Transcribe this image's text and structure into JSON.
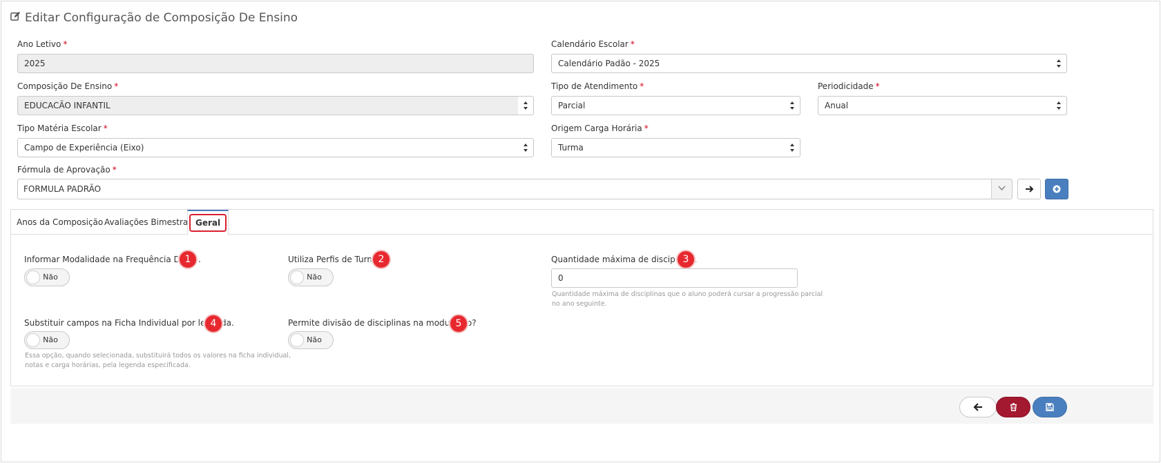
{
  "page": {
    "title": "Editar Configuração de Composição De Ensino",
    "required_mark": "*"
  },
  "fields": {
    "ano_letivo": {
      "label": "Ano Letivo",
      "value": "2025"
    },
    "calendario_escolar": {
      "label": "Calendário Escolar",
      "value": "Calendário Padão - 2025"
    },
    "composicao_ensino": {
      "label": "Composição De Ensino",
      "value": "EDUCACÃO INFANTIL"
    },
    "tipo_atendimento": {
      "label": "Tipo de Atendimento",
      "value": "Parcial"
    },
    "periodicidade": {
      "label": "Periodicidade",
      "value": "Anual"
    },
    "tipo_materia": {
      "label": "Tipo Matéria Escolar",
      "value": "Campo de Experiência (Eixo)"
    },
    "origem_carga": {
      "label": "Origem Carga Horária",
      "value": "Turma"
    },
    "formula_aprovacao": {
      "label": "Fórmula de Aprovação",
      "value": "FORMULA PADRÃO"
    }
  },
  "tabs": [
    {
      "label": "Anos da Composição"
    },
    {
      "label": "Avaliações Bimestrais"
    },
    {
      "label": "Geral"
    }
  ],
  "geral": {
    "opt1": {
      "label": "Informar Modalidade na Frequência Diária.",
      "badge": "1",
      "toggle": "Não"
    },
    "opt2": {
      "label": "Utiliza Perfis de Turma",
      "badge": "2",
      "toggle": "Não"
    },
    "opt3": {
      "label": "Quantidade máxima de disciplinas.",
      "badge": "3",
      "value": "0",
      "help_line1": "Quantidade máxima de disciplinas que o aluno poderá cursar a progressão parcial",
      "help_line2": "no ano seguinte."
    },
    "opt4": {
      "label": "Substituir campos na Ficha Individual por legenda.",
      "badge": "4",
      "toggle": "Não",
      "help_line1": "Essa opção, quando selecionada, substituirá todos os valores na ficha individual,",
      "help_line2": "notas e carga horárias, pela legenda especificada."
    },
    "opt5": {
      "label": "Permite divisão de disciplinas na modulação?",
      "badge": "5",
      "toggle": "Não"
    }
  },
  "colors": {
    "accent": "#4a7fbf",
    "danger": "#a3192f",
    "badge": "#e8282f"
  },
  "icons": {
    "title": "edit-icon",
    "back": "arrow-left-icon",
    "delete": "trash-icon",
    "save": "floppy-disk-icon"
  }
}
